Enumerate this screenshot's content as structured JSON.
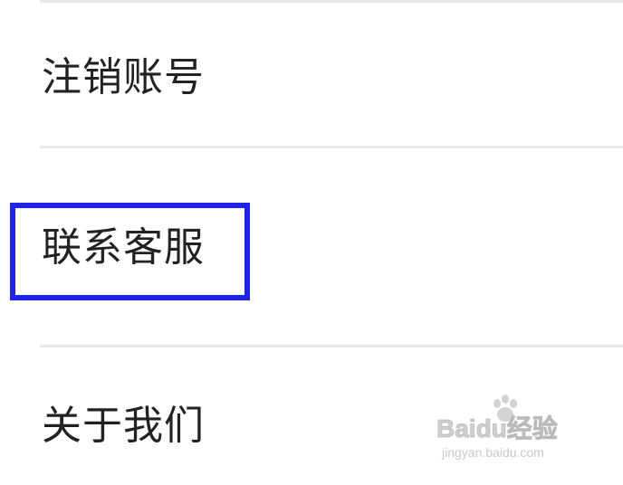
{
  "menu": {
    "items": [
      {
        "label": "注销账号"
      },
      {
        "label": "联系客服"
      },
      {
        "label": "关于我们"
      }
    ]
  },
  "watermark": {
    "logo": "Baidu经验",
    "url": "jingyan.baidu.com"
  },
  "colors": {
    "highlight": "#1f23e6",
    "divider": "#e9e9e9",
    "text": "#222222"
  }
}
